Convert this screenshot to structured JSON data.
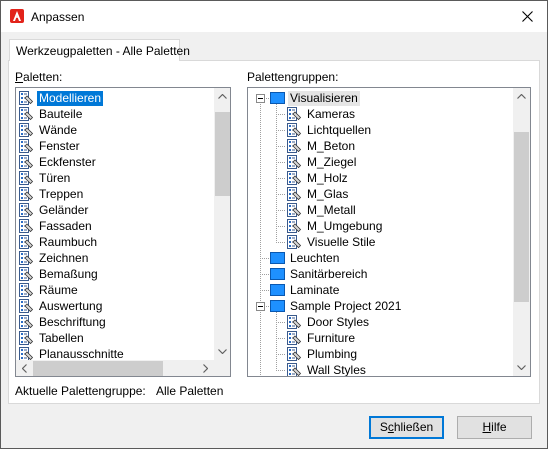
{
  "window": {
    "title": "Anpassen",
    "close_label": "×"
  },
  "tab": {
    "label": "Werkzeugpaletten - Alle Paletten"
  },
  "palettes": {
    "label_first": "P",
    "label_rest": "aletten:",
    "items": [
      "Modellieren",
      "Bauteile",
      "Wände",
      "Fenster",
      "Eckfenster",
      "Türen",
      "Treppen",
      "Geländer",
      "Fassaden",
      "Raumbuch",
      "Zeichnen",
      "Bemaßung",
      "Räume",
      "Auswertung",
      "Beschriftung",
      "Tabellen",
      "Planausschnitte"
    ],
    "selected_index": 0
  },
  "groups": {
    "label": "Palettengruppen:",
    "tree": [
      {
        "label": "Visualisieren",
        "type": "group",
        "level": 0,
        "expanded": true
      },
      {
        "label": "Kameras",
        "type": "palette",
        "level": 1
      },
      {
        "label": "Lichtquellen",
        "type": "palette",
        "level": 1
      },
      {
        "label": "M_Beton",
        "type": "palette",
        "level": 1
      },
      {
        "label": "M_Ziegel",
        "type": "palette",
        "level": 1
      },
      {
        "label": "M_Holz",
        "type": "palette",
        "level": 1
      },
      {
        "label": "M_Glas",
        "type": "palette",
        "level": 1
      },
      {
        "label": "M_Metall",
        "type": "palette",
        "level": 1
      },
      {
        "label": "M_Umgebung",
        "type": "palette",
        "level": 1
      },
      {
        "label": "Visuelle Stile",
        "type": "palette",
        "level": 1
      },
      {
        "label": "Leuchten",
        "type": "group",
        "level": 0,
        "expanded": false
      },
      {
        "label": "Sanitärbereich",
        "type": "group",
        "level": 0,
        "expanded": false
      },
      {
        "label": "Laminate",
        "type": "group",
        "level": 0,
        "expanded": false
      },
      {
        "label": "Sample Project 2021",
        "type": "group",
        "level": 0,
        "expanded": true
      },
      {
        "label": "Door Styles",
        "type": "palette",
        "level": 1
      },
      {
        "label": "Furniture",
        "type": "palette",
        "level": 1
      },
      {
        "label": "Plumbing",
        "type": "palette",
        "level": 1
      },
      {
        "label": "Wall Styles",
        "type": "palette",
        "level": 1
      }
    ]
  },
  "current_group": {
    "label": "Aktuelle Palettengruppe:",
    "value": "Alle Paletten"
  },
  "buttons": {
    "close_first": "S",
    "close_u": "c",
    "close_rest": "hließen",
    "help_first": "",
    "help_u": "H",
    "help_rest": "ilfe"
  },
  "colors": {
    "selection": "#0078d7",
    "group_icon": "#1e90ff",
    "app_icon": "#e2231a"
  }
}
